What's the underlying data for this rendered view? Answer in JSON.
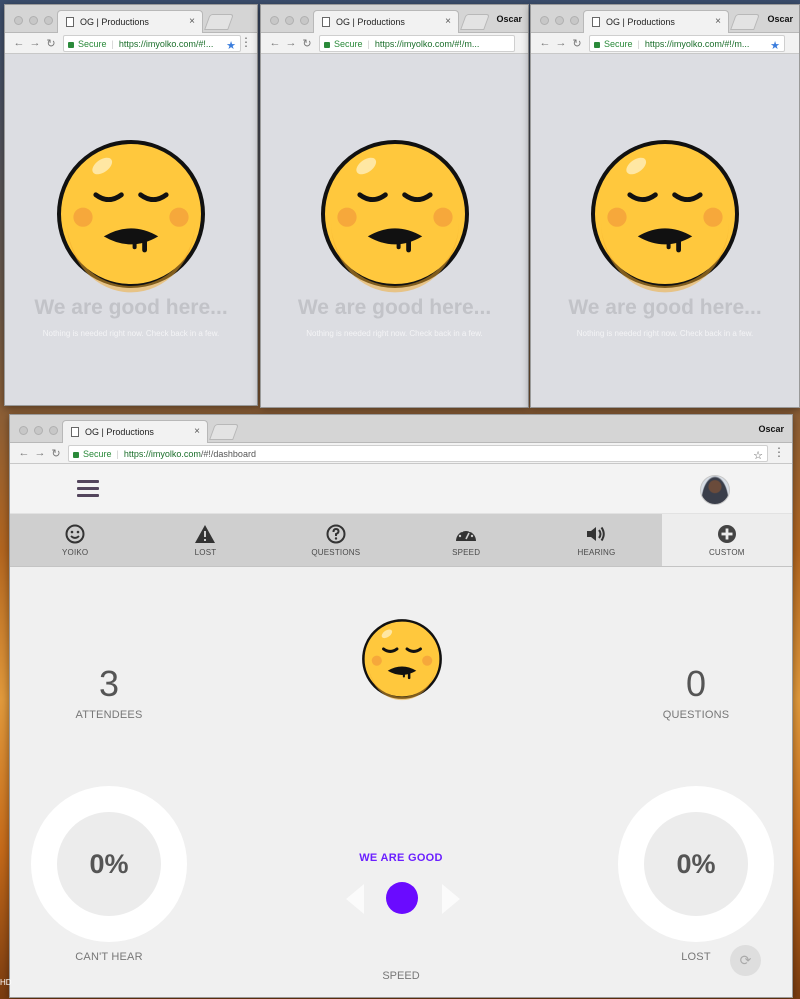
{
  "browser": {
    "tab_title": "OG | Productions",
    "tab_close": "×",
    "user": "Oscar",
    "secure_label": "Secure",
    "url_small_1": "https://imyolko.com/#!...",
    "url_small_2": "https://imyolko.com/#!/m...",
    "url_small_3": "https://imyolko.com/#!/m...",
    "url_main_host": "https://imyolko.com",
    "url_main_path": "/#!/dashboard",
    "back": "←",
    "forward": "→",
    "reload": "↻",
    "star": "★",
    "star_outline": "☆",
    "menu": "⋮"
  },
  "empty_state": {
    "title": "We are good here...",
    "subtitle": "Nothing is needed right now. Check back in a few."
  },
  "toolbar": {
    "items": [
      {
        "label": "YOIKO",
        "icon": "smiley-icon"
      },
      {
        "label": "LOST",
        "icon": "warning-icon"
      },
      {
        "label": "QUESTIONS",
        "icon": "question-icon"
      },
      {
        "label": "SPEED",
        "icon": "speedometer-icon"
      },
      {
        "label": "HEARING",
        "icon": "volume-icon"
      },
      {
        "label": "CUSTOM",
        "icon": "plus-circle-icon"
      }
    ]
  },
  "dashboard": {
    "attendees_count": "3",
    "attendees_label": "ATTENDEES",
    "questions_count": "0",
    "questions_label": "QUESTIONS",
    "cant_hear_pct": "0%",
    "cant_hear_label": "CAN'T HEAR",
    "lost_pct": "0%",
    "lost_label": "LOST",
    "speed_status": "WE ARE GOOD",
    "speed_label": "SPEED"
  },
  "colors": {
    "accent": "#6a0bff",
    "emoji_yellow": "#ffc83d",
    "emoji_outline": "#111111"
  },
  "desktop": {
    "corner_text": "HD"
  }
}
